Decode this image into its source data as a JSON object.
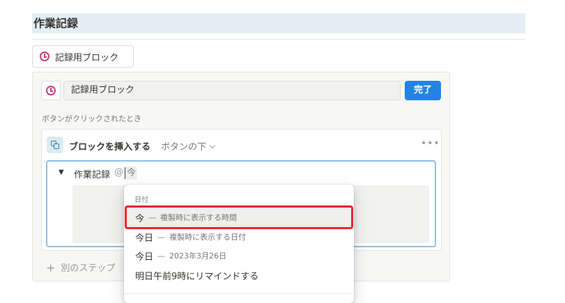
{
  "heading": "作業記録",
  "button_block": {
    "label": "記録用ブロック",
    "icon": "clock-icon"
  },
  "editor": {
    "name_value": "記録用ブロック",
    "done_label": "完了",
    "when_label": "ボタンがクリックされたとき",
    "action": {
      "title": "ブロックを挿入する",
      "position": "ボタンの下",
      "more": "•••"
    },
    "template": {
      "toggle_text": "作業記録",
      "mention_at": "@",
      "mention_query": "今"
    },
    "add_step": "別のステップ"
  },
  "dropdown": {
    "section": "日付",
    "items": [
      {
        "main": "今",
        "dash": "—",
        "sub": "複製時に表示する時間",
        "selected": true
      },
      {
        "main": "今日",
        "dash": "—",
        "sub": "複製時に表示する日付"
      },
      {
        "main": "今日",
        "dash": "—",
        "sub": "2023年3月26日"
      },
      {
        "main": "明日午前9時にリマインドする"
      }
    ]
  },
  "colors": {
    "accent": "#2383e2",
    "highlight": "#e8262f",
    "heading_bg": "#e3eff5",
    "clock": "#c4407d"
  }
}
